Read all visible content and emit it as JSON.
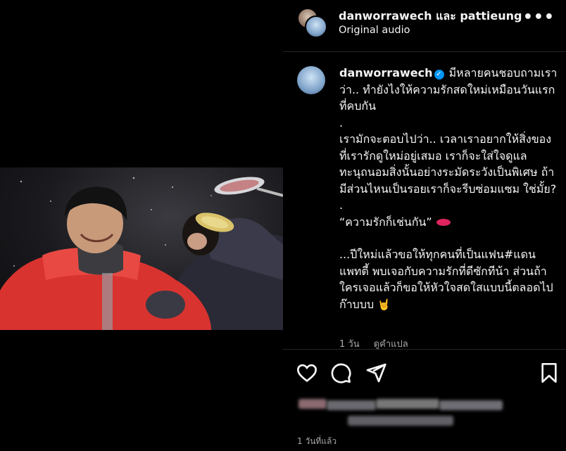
{
  "header": {
    "title": "danworrawech และ pattieung",
    "subtitle": "Original audio"
  },
  "post": {
    "username": "danworrawech",
    "caption_first": "มีหลายคนชอบถามเราว่า.. ทำยังไงให้ความรักสดใหม่เหมือนวันแรกที่คบกัน",
    "caption_lines": [
      ".",
      "เรามักจะตอบไปว่า.. เวลาเราอยากให้สิ่งของที่เรารักดูใหม่อยู่เสมอ เราก็จะใส่ใจดูแลทะนุถนอมสิ่งนั้นอย่างระมัดระวังเป็นพิเศษ ถ้ามีส่วนไหนเป็นรอยเราก็จะรีบซ่อมแซม ใช่มั้ย?",
      ".",
      "“ความรักก็เช่นกัน”",
      "",
      "...ปีใหม่แล้วขอให้ทุกคนที่เป็นแฟน#แดนแพทตี้ พบเจอกับความรักที่ดีซักทีน้า ส่วนถ้าใครเจอแล้วก็ขอให้หัวใจสดใสแบบนี้ตลอดไปก๊าบบบ"
    ],
    "time_ago": "1 วัน",
    "translate_label": "ดูคำแปล",
    "date_label": "1 วันที่แล้ว"
  },
  "icons": {
    "more": "more-horizontal-icon",
    "like": "heart-icon",
    "comment": "comment-icon",
    "share": "send-icon",
    "save": "bookmark-icon"
  },
  "colors": {
    "background": "#000000",
    "text": "#f5f5f5",
    "muted": "#a8a8a8",
    "verified": "#0095f6",
    "divider": "#262626"
  }
}
